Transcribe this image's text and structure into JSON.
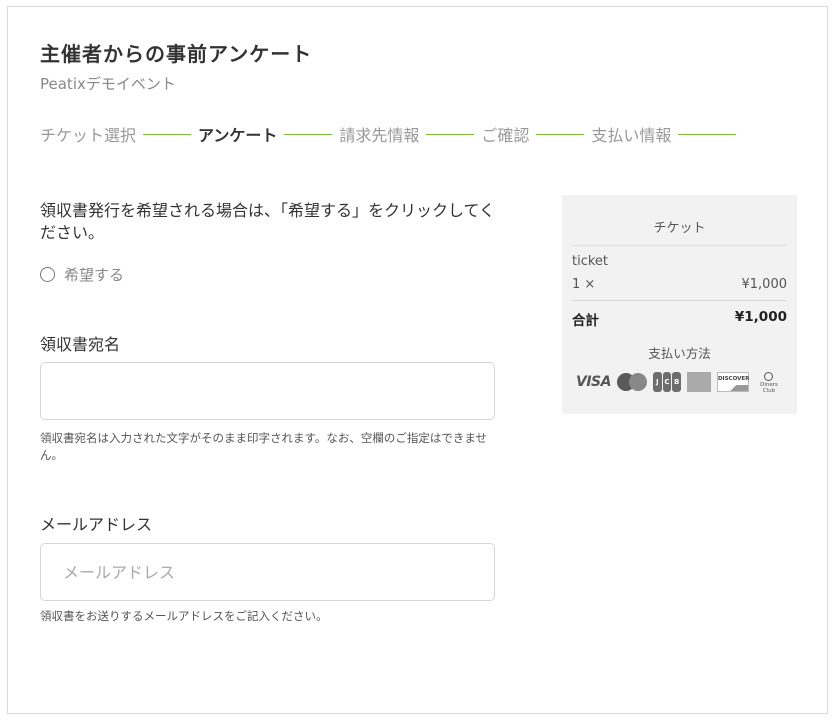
{
  "header": {
    "title": "主催者からの事前アンケート",
    "event_name": "Peatixデモイベント"
  },
  "steps": [
    {
      "label": "チケット選択",
      "active": false
    },
    {
      "label": "アンケート",
      "active": true
    },
    {
      "label": "請求先情報",
      "active": false
    },
    {
      "label": "ご確認",
      "active": false
    },
    {
      "label": "支払い情報",
      "active": false
    }
  ],
  "form": {
    "receipt_question": "領収書発行を希望される場合は、「希望する」をクリックしてください。",
    "receipt_option": "希望する",
    "addressee_label": "領収書宛名",
    "addressee_value": "",
    "addressee_placeholder": "",
    "addressee_help": "領収書宛名は入力された文字がそのまま印字されます。なお、空欄のご指定はできません。",
    "email_label": "メールアドレス",
    "email_value": "",
    "email_placeholder": "メールアドレス",
    "email_help": "領収書をお送りするメールアドレスをご記入ください。"
  },
  "summary": {
    "heading": "チケット",
    "item_name": "ticket",
    "item_qty": "1 ×",
    "item_price": "¥1,000",
    "total_label": "合計",
    "total_value": "¥1,000",
    "payment_label": "支払い方法",
    "cards": {
      "visa": "VISA",
      "jcb_letters": [
        "J",
        "C",
        "B"
      ],
      "discover": "DISCOVER",
      "diners": "Diners Club"
    }
  },
  "colors": {
    "step_line": "#7cbd3a",
    "panel_bg": "#f2f2f2"
  }
}
